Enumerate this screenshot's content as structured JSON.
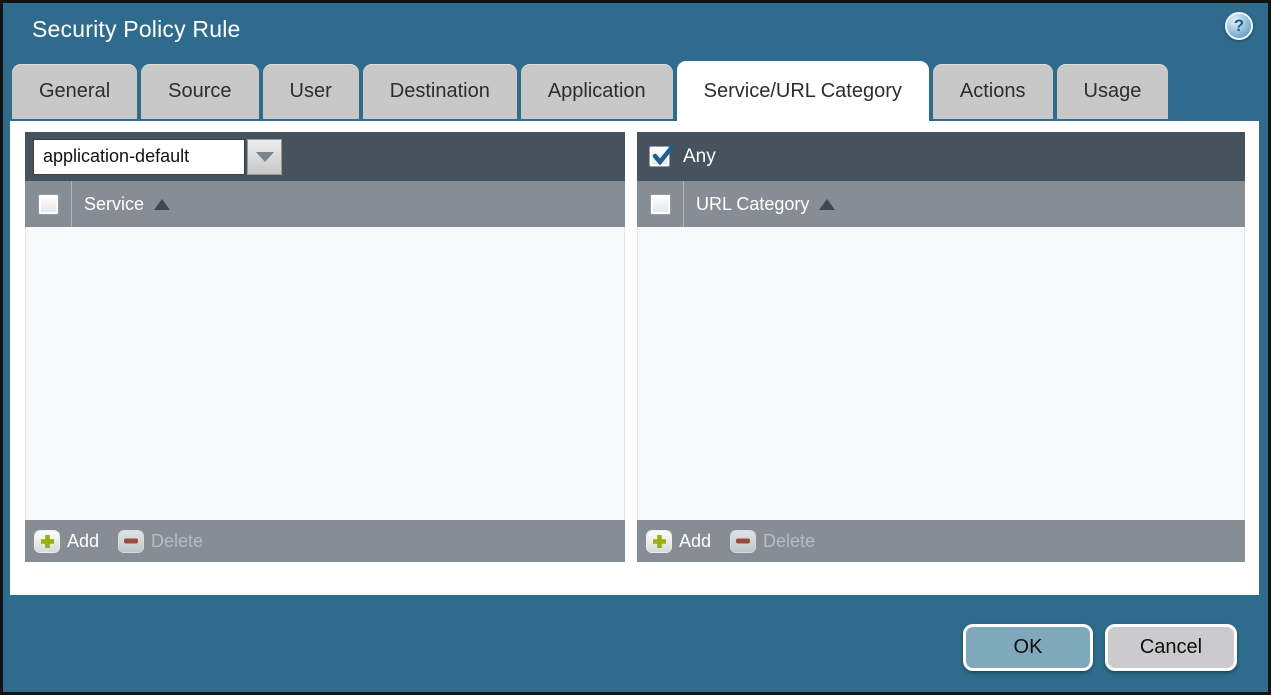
{
  "window": {
    "title": "Security Policy Rule"
  },
  "help": {
    "glyph": "?"
  },
  "tabs": [
    {
      "label": "General",
      "active": false
    },
    {
      "label": "Source",
      "active": false
    },
    {
      "label": "User",
      "active": false
    },
    {
      "label": "Destination",
      "active": false
    },
    {
      "label": "Application",
      "active": false
    },
    {
      "label": "Service/URL Category",
      "active": true
    },
    {
      "label": "Actions",
      "active": false
    },
    {
      "label": "Usage",
      "active": false
    }
  ],
  "service_panel": {
    "mode_dropdown": {
      "value": "application-default"
    },
    "header": {
      "label": "Service",
      "checkbox_checked": false,
      "sort": "ascending"
    },
    "rows": [],
    "footer": {
      "add_label": "Add",
      "delete_label": "Delete",
      "delete_enabled": false
    }
  },
  "url_category_panel": {
    "any_checkbox": {
      "label": "Any",
      "checked": true
    },
    "header": {
      "label": "URL Category",
      "checkbox_checked": false,
      "sort": "ascending"
    },
    "rows": [],
    "footer": {
      "add_label": "Add",
      "delete_label": "Delete",
      "delete_enabled": false
    }
  },
  "actions": {
    "ok_label": "OK",
    "cancel_label": "Cancel"
  },
  "colors": {
    "background": "#2f6b8c",
    "panel_bar": "#46525d",
    "panel_header": "#868d94",
    "tab_inactive": "#c8c8c8",
    "tab_active": "#ffffff",
    "ok_button": "#7fa8bd",
    "cancel_button": "#cbcbcd",
    "add_icon": "#96b00e",
    "delete_icon": "#9c4b41",
    "check_mark": "#1f5e95"
  }
}
